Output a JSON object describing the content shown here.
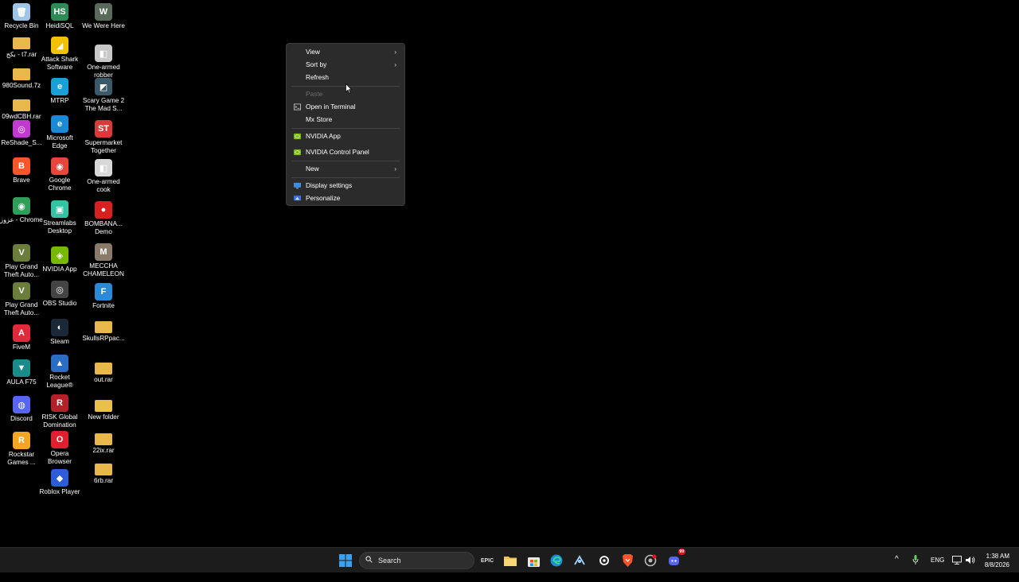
{
  "desktop": {
    "icons": [
      {
        "label": "Recycle Bin",
        "color": "#9ec5e8",
        "glyph": "🗑"
      },
      {
        "label": "بكج - t7.rar",
        "color": "#e8b84a",
        "glyph": ""
      },
      {
        "label": "980Sound.7z",
        "color": "#e8b84a",
        "glyph": ""
      },
      {
        "label": "09wdCBH.rar",
        "color": "#e8b84a",
        "glyph": ""
      },
      {
        "label": "ReShade_S...",
        "color": "#c03ad0",
        "glyph": "◎"
      },
      {
        "label": "Brave",
        "color": "#fb542b",
        "glyph": "B"
      },
      {
        "label": "عزوز - Chrome",
        "color": "#2f9e5a",
        "glyph": "◉"
      },
      {
        "label": "Play Grand Theft Auto...",
        "color": "#6b7d3a",
        "glyph": "V"
      },
      {
        "label": "Play Grand Theft Auto...",
        "color": "#6b7d3a",
        "glyph": "V"
      },
      {
        "label": "FiveM",
        "color": "#e02a3b",
        "glyph": "A"
      },
      {
        "label": "AULA F75",
        "color": "#1a8b8b",
        "glyph": "▼"
      },
      {
        "label": "Discord",
        "color": "#5865f2",
        "glyph": "◍"
      },
      {
        "label": "Rockstar Games ...",
        "color": "#f4a623",
        "glyph": "R"
      },
      {
        "label": "HeidiSQL",
        "color": "#2e8b57",
        "glyph": "HS"
      },
      {
        "label": "Attack Shark Software",
        "color": "#f2c200",
        "glyph": "◢"
      },
      {
        "label": "MTRP",
        "color": "#1aa0d8",
        "glyph": "e"
      },
      {
        "label": "Microsoft Edge",
        "color": "#1a8ad8",
        "glyph": "e"
      },
      {
        "label": "Google Chrome",
        "color": "#e8453c",
        "glyph": "◉"
      },
      {
        "label": "Streamlabs Desktop",
        "color": "#31c3a2",
        "glyph": "▣"
      },
      {
        "label": "NVIDIA App",
        "color": "#76b900",
        "glyph": "◈"
      },
      {
        "label": "OBS Studio",
        "color": "#444444",
        "glyph": "◎"
      },
      {
        "label": "Steam",
        "color": "#1b2838",
        "glyph": "◐"
      },
      {
        "label": "Rocket League®",
        "color": "#2b6cc4",
        "glyph": "▲"
      },
      {
        "label": "RISK Global Domination",
        "color": "#b3202a",
        "glyph": "R"
      },
      {
        "label": "Opera Browser",
        "color": "#e0202e",
        "glyph": "O"
      },
      {
        "label": "Roblox Player",
        "color": "#2e5bd8",
        "glyph": "◆"
      },
      {
        "label": "We Were Here",
        "color": "#5a6a5a",
        "glyph": "W"
      },
      {
        "label": "One-armed robber",
        "color": "#c8c8c8",
        "glyph": "◧"
      },
      {
        "label": "Scary Game 2 The Mad S...",
        "color": "#3a5a6a",
        "glyph": "◩"
      },
      {
        "label": "Supermarket Together",
        "color": "#d83a3a",
        "glyph": "ST"
      },
      {
        "label": "One-armed cook",
        "color": "#d8d8d8",
        "glyph": "◧"
      },
      {
        "label": "BOMBANA... Demo",
        "color": "#d82020",
        "glyph": "●"
      },
      {
        "label": "MECCHA CHAMELEON",
        "color": "#8a7a6a",
        "glyph": "M"
      },
      {
        "label": "Fortnite",
        "color": "#2a8ad8",
        "glyph": "F"
      },
      {
        "label": "SkullsRPpac...",
        "color": "#e8b84a",
        "glyph": ""
      },
      {
        "label": "out.rar",
        "color": "#e8b84a",
        "glyph": ""
      },
      {
        "label": "New folder",
        "color": "#e8c04a",
        "glyph": ""
      },
      {
        "label": "22ix.rar",
        "color": "#e8b84a",
        "glyph": ""
      },
      {
        "label": "6rb.rar",
        "color": "#e8b84a",
        "glyph": ""
      }
    ]
  },
  "context_menu": {
    "view": "View",
    "sort_by": "Sort by",
    "refresh": "Refresh",
    "paste": "Paste",
    "open_terminal": "Open in Terminal",
    "mx_store": "Mx Store",
    "nvidia_app": "NVIDIA App",
    "nvidia_control_panel": "NVIDIA Control Panel",
    "new": "New",
    "display_settings": "Display settings",
    "personalize": "Personalize"
  },
  "taskbar": {
    "search_placeholder": "Search",
    "language": "ENG",
    "time": "1:38 AM",
    "date": "8/8/2026",
    "discord_badge": "99"
  }
}
